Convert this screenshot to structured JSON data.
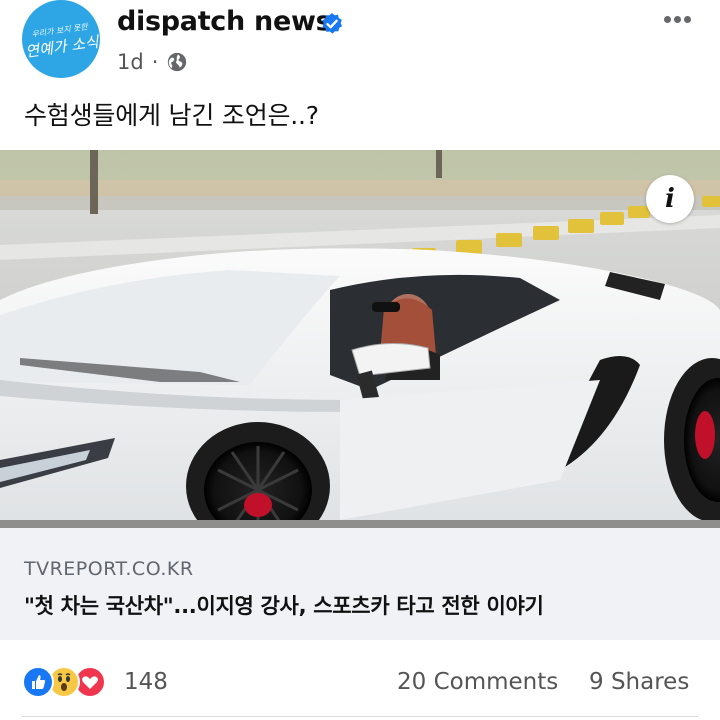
{
  "post": {
    "page_name": "dispatch news",
    "avatar_text_small": "우리가 보지 못한",
    "avatar_text": "연예가 소식",
    "time": "1d",
    "separator": "·",
    "caption": "수험생들에게 남긴 조언은..?"
  },
  "link_preview": {
    "info_label": "i",
    "domain": "TVREPORT.CO.KR",
    "headline": "\"첫 차는 국산차\"...이지영 강사, 스포츠카 타고 전한 이야기"
  },
  "engagement": {
    "reaction_count": "148",
    "comments": "20 Comments",
    "shares": "9 Shares"
  },
  "icons": [
    "verified-badge-icon",
    "globe-icon",
    "more-options-icon",
    "info-icon",
    "like-reaction-icon",
    "wow-reaction-icon",
    "love-reaction-icon"
  ],
  "colors": {
    "avatar_bg": "#2ea6e6",
    "verified_blue": "#1877f2",
    "link_bg": "#f0f2f5",
    "like_blue": "#1877f2",
    "love_red": "#f0364f",
    "wow_yellow": "#f7c846"
  }
}
